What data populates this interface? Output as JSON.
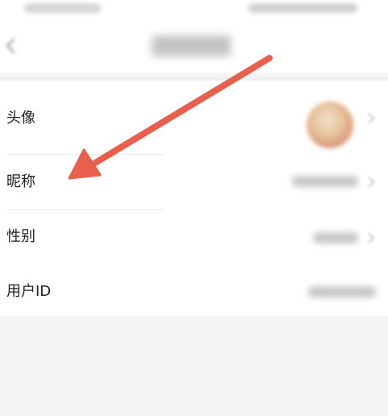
{
  "colors": {
    "annotation_arrow": "#e8604c",
    "row_text": "#222222",
    "page_background": "#f5f5f5"
  },
  "nav": {
    "back_icon": "chevron-left-icon"
  },
  "profile": {
    "rows": [
      {
        "label": "头像"
      },
      {
        "label": "昵称"
      },
      {
        "label": "性别"
      },
      {
        "label": "用户ID"
      }
    ]
  }
}
